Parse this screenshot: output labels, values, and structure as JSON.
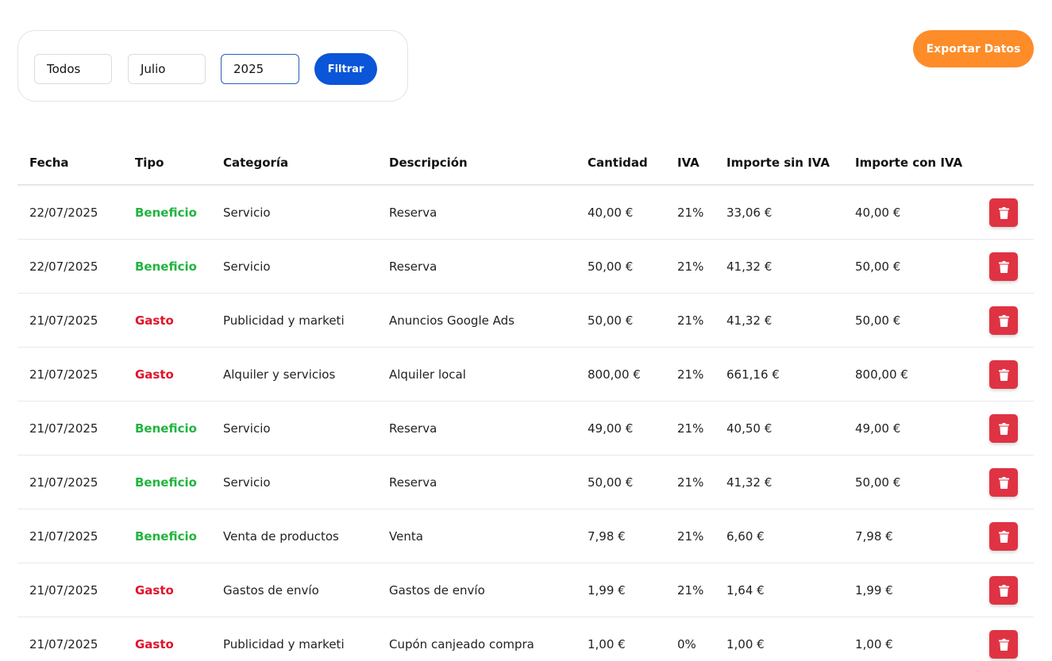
{
  "filters": {
    "tipo_value": "Todos",
    "mes_value": "Julio",
    "anio_value": "2025",
    "filter_label": "Filtrar"
  },
  "export_label": "Exportar Datos",
  "table": {
    "headers": [
      "Fecha",
      "Tipo",
      "Categoría",
      "Descripción",
      "Cantidad",
      "IVA",
      "Importe sin IVA",
      "Importe con IVA"
    ],
    "rows": [
      {
        "fecha": "22/07/2025",
        "tipo": "Beneficio",
        "categoria": "Servicio",
        "descripcion": "Reserva",
        "cantidad": "40,00 €",
        "iva": "21%",
        "sin_iva": "33,06 €",
        "con_iva": "40,00 €"
      },
      {
        "fecha": "22/07/2025",
        "tipo": "Beneficio",
        "categoria": "Servicio",
        "descripcion": "Reserva",
        "cantidad": "50,00 €",
        "iva": "21%",
        "sin_iva": "41,32 €",
        "con_iva": "50,00 €"
      },
      {
        "fecha": "21/07/2025",
        "tipo": "Gasto",
        "categoria": "Publicidad y marketi",
        "descripcion": "Anuncios Google Ads",
        "cantidad": "50,00 €",
        "iva": "21%",
        "sin_iva": "41,32 €",
        "con_iva": "50,00 €"
      },
      {
        "fecha": "21/07/2025",
        "tipo": "Gasto",
        "categoria": "Alquiler y servicios",
        "descripcion": "Alquiler local",
        "cantidad": "800,00 €",
        "iva": "21%",
        "sin_iva": "661,16 €",
        "con_iva": "800,00 €"
      },
      {
        "fecha": "21/07/2025",
        "tipo": "Beneficio",
        "categoria": "Servicio",
        "descripcion": "Reserva",
        "cantidad": "49,00 €",
        "iva": "21%",
        "sin_iva": "40,50 €",
        "con_iva": "49,00 €"
      },
      {
        "fecha": "21/07/2025",
        "tipo": "Beneficio",
        "categoria": "Servicio",
        "descripcion": "Reserva",
        "cantidad": "50,00 €",
        "iva": "21%",
        "sin_iva": "41,32 €",
        "con_iva": "50,00 €"
      },
      {
        "fecha": "21/07/2025",
        "tipo": "Beneficio",
        "categoria": "Venta de productos",
        "descripcion": "Venta",
        "cantidad": "7,98 €",
        "iva": "21%",
        "sin_iva": "6,60 €",
        "con_iva": "7,98 €"
      },
      {
        "fecha": "21/07/2025",
        "tipo": "Gasto",
        "categoria": "Gastos de envío",
        "descripcion": "Gastos de envío",
        "cantidad": "1,99 €",
        "iva": "21%",
        "sin_iva": "1,64 €",
        "con_iva": "1,99 €"
      },
      {
        "fecha": "21/07/2025",
        "tipo": "Gasto",
        "categoria": "Publicidad y marketi",
        "descripcion": "Cupón canjeado compra",
        "cantidad": "1,00 €",
        "iva": "0%",
        "sin_iva": "1,00 €",
        "con_iva": "1,00 €"
      }
    ]
  },
  "colors": {
    "beneficio": "#22b43f",
    "gasto": "#e0142b",
    "filter_button": "#0a55d8",
    "export_button": "#fd8c29",
    "delete_button": "#df3343"
  },
  "icons": {
    "delete": "trash-icon"
  }
}
